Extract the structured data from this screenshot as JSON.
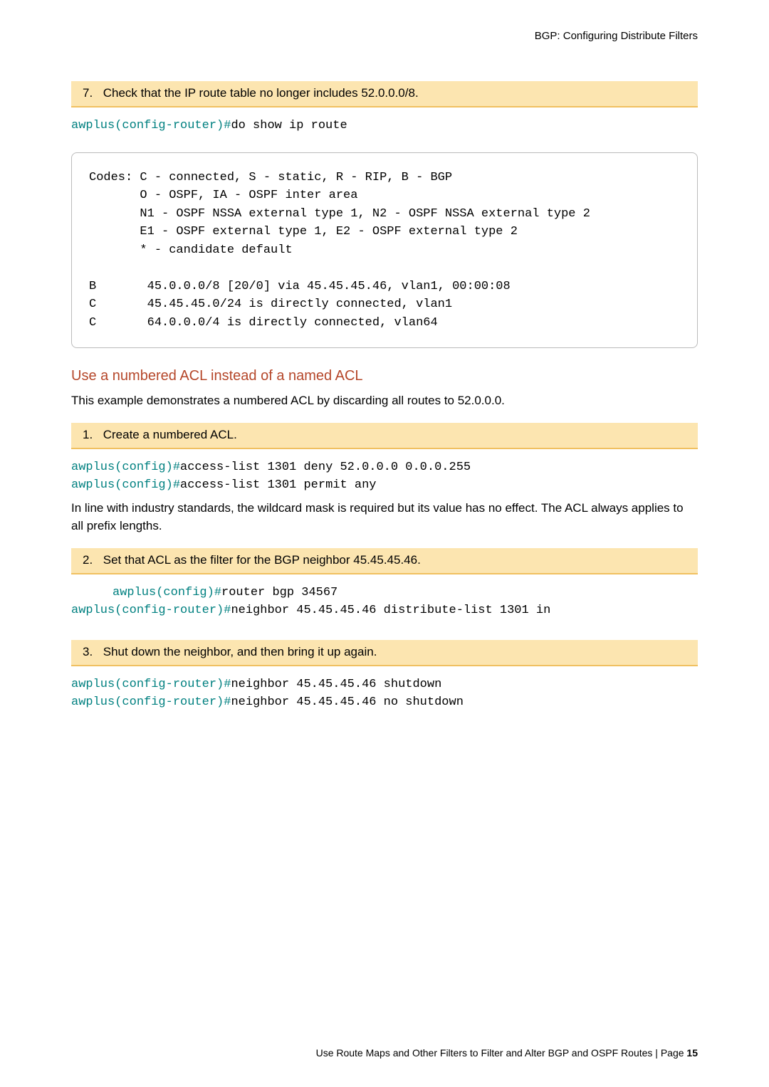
{
  "header": {
    "doc_title": "BGP: Configuring Distribute Filters"
  },
  "steps": {
    "s7": {
      "num": "7.",
      "text": "Check that the IP route table no longer includes 52.0.0.0/8."
    },
    "s1": {
      "num": "1.",
      "text": "Create a numbered ACL."
    },
    "s2": {
      "num": "2.",
      "text": "Set that ACL as the filter for the BGP neighbor 45.45.45.46."
    },
    "s3": {
      "num": "3.",
      "text": "Shut down the neighbor, and then bring it up again."
    }
  },
  "cmds": {
    "p_cfg_router": "awplus(config-router)#",
    "p_cfg": "awplus(config)#",
    "do_show": "do show ip route",
    "acl_deny": "access-list 1301 deny 52.0.0.0 0.0.0.255",
    "acl_permit": "access-list 1301 permit any",
    "router_bgp": "router bgp 34567",
    "neigh_dist": "neighbor 45.45.45.46 distribute-list 1301 in",
    "neigh_shut": "neighbor 45.45.45.46 shutdown",
    "neigh_noshut": "neighbor 45.45.45.46 no shutdown"
  },
  "output": {
    "text": "Codes: C - connected, S - static, R - RIP, B - BGP\n       O - OSPF, IA - OSPF inter area\n       N1 - OSPF NSSA external type 1, N2 - OSPF NSSA external type 2\n       E1 - OSPF external type 1, E2 - OSPF external type 2\n       * - candidate default\n\nB       45.0.0.0/8 [20/0] via 45.45.45.46, vlan1, 00:00:08\nC       45.45.45.0/24 is directly connected, vlan1\nC       64.0.0.0/4 is directly connected, vlan64"
  },
  "section": {
    "heading": "Use a numbered ACL instead of a named ACL",
    "para1": "This example demonstrates a numbered ACL by discarding all routes to 52.0.0.0.",
    "para2": "In line with industry standards, the wildcard mask is required but its value has no effect. The ACL always applies to all prefix lengths."
  },
  "footer": {
    "text": "Use Route Maps and Other Filters to Filter and Alter BGP and OSPF Routes | Page ",
    "page_label": "15"
  }
}
